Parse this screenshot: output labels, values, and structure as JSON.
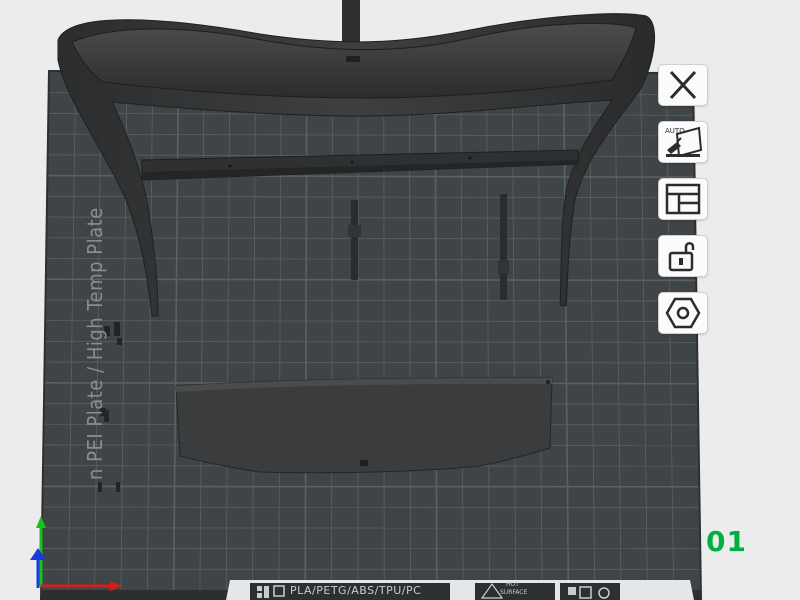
{
  "plate": {
    "number": "01",
    "label": "Cool Plate / Smooth PEI Plate / High Temp Plate",
    "visible_label": "n PEI Plate / High Temp Plate",
    "bed_strip_text": "PLA/PETG/ABS/TPU/PC",
    "hot_surface": [
      "HOT",
      "SURFACE"
    ]
  },
  "toolbar": {
    "close_tooltip": "Close",
    "auto_orient_badge": "AUTO",
    "arrange_tooltip": "Arrange",
    "lock_tooltip": "Lock",
    "settings_tooltip": "Plate settings"
  },
  "colors": {
    "accent": "#00ae42",
    "bed": "#3f4446",
    "grid": "#5b6163",
    "model": "#3a3b3c",
    "background": "#ececec"
  }
}
